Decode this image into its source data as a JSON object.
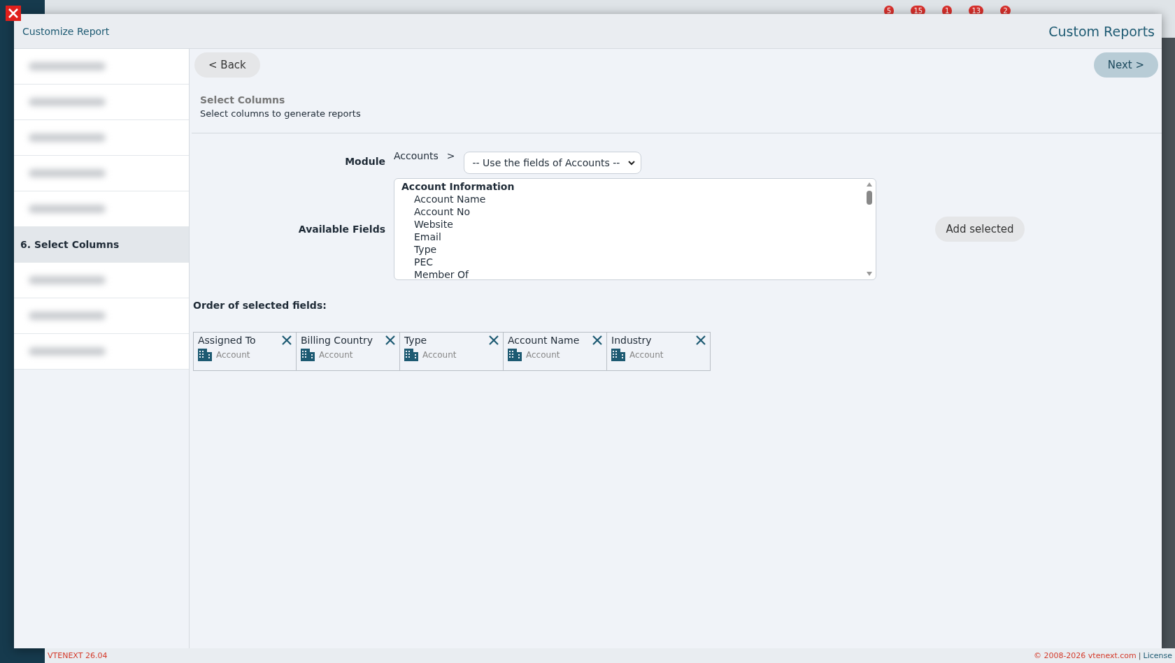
{
  "background_topbar": {
    "badges": [
      "5",
      "15",
      "1",
      "13",
      "2"
    ]
  },
  "modal": {
    "title": "Customize Report",
    "heading": "Custom Reports"
  },
  "sidebar": {
    "items": [
      {
        "blurred": true,
        "selected": false
      },
      {
        "blurred": true,
        "selected": false
      },
      {
        "blurred": true,
        "selected": false
      },
      {
        "blurred": true,
        "selected": false
      },
      {
        "blurred": true,
        "selected": false
      },
      {
        "label": "6. Select Columns",
        "blurred": false,
        "selected": true
      },
      {
        "blurred": true,
        "selected": false
      },
      {
        "blurred": true,
        "selected": false
      },
      {
        "blurred": true,
        "selected": false
      }
    ]
  },
  "buttons": {
    "back": "< Back",
    "next": "Next >",
    "add": "Add selected"
  },
  "section": {
    "title": "Select Columns",
    "subtitle": "Select columns to generate reports"
  },
  "module": {
    "label": "Module",
    "value": "Accounts",
    "separator": ">",
    "select": "-- Use the fields of Accounts --"
  },
  "available_fields": {
    "label": "Available Fields",
    "group": "Account Information",
    "items": [
      "Account Name",
      "Account No",
      "Website",
      "Email",
      "Type",
      "PEC",
      "Member Of"
    ]
  },
  "selected_fields": {
    "label": "Order of selected fields:",
    "items": [
      {
        "name": "Assigned To",
        "module": "Account"
      },
      {
        "name": "Billing Country",
        "module": "Account"
      },
      {
        "name": "Type",
        "module": "Account"
      },
      {
        "name": "Account Name",
        "module": "Account"
      },
      {
        "name": "Industry",
        "module": "Account"
      }
    ]
  },
  "footer": {
    "version": "VTENEXT 26.04",
    "copyright": "© 2008-2026 vtenext.com",
    "separator": "|",
    "license": "License"
  }
}
